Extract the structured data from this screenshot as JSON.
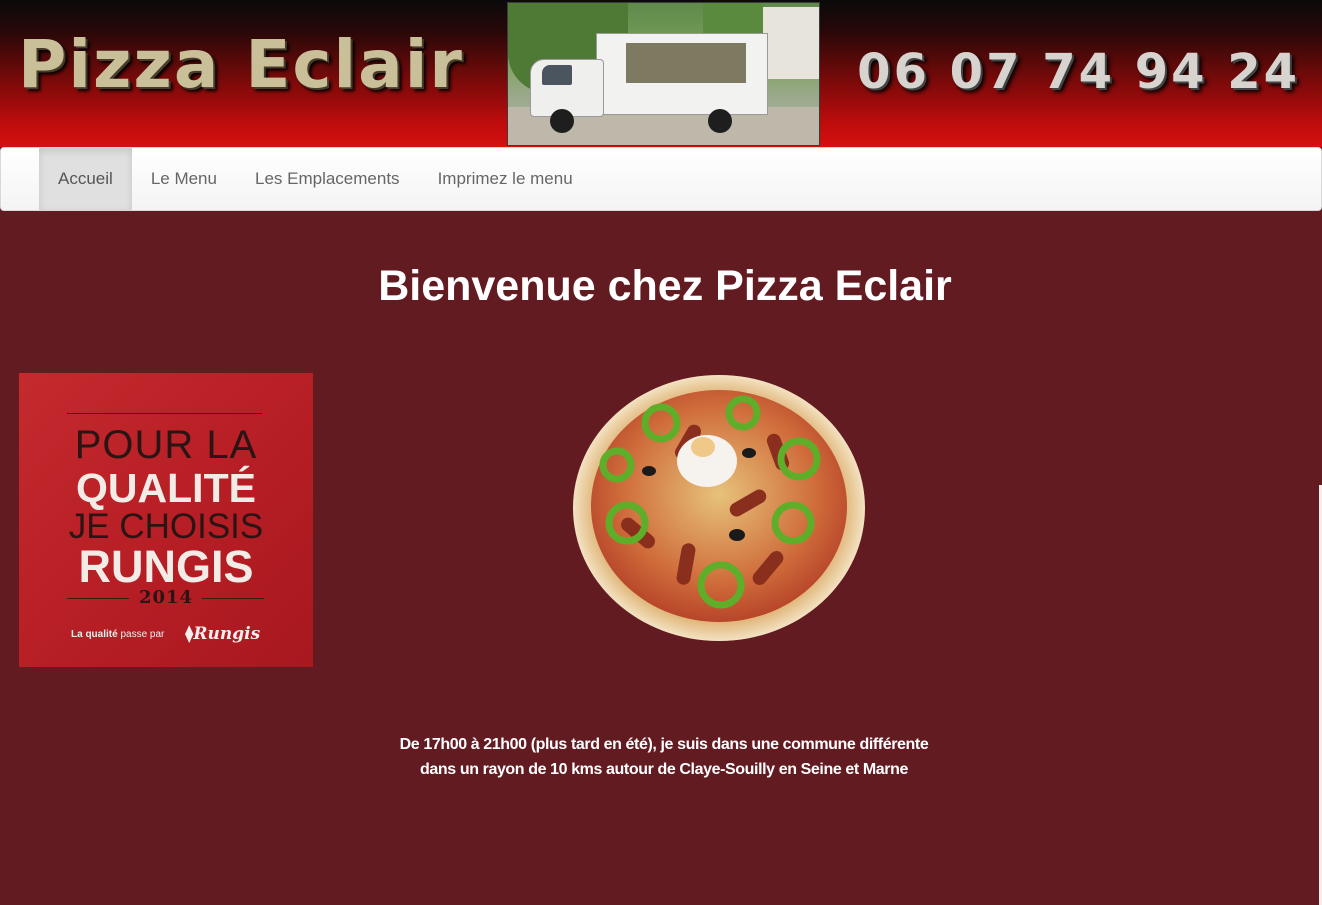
{
  "header": {
    "brand": "Pizza Eclair",
    "phone": "06 07 74 94 24",
    "photo": "food-truck-photo"
  },
  "nav": {
    "items": [
      {
        "label": "Accueil",
        "active": true
      },
      {
        "label": "Le Menu",
        "active": false
      },
      {
        "label": "Les Emplacements",
        "active": false
      },
      {
        "label": "Imprimez le menu",
        "active": false
      }
    ]
  },
  "main": {
    "title": "Bienvenue chez Pizza Eclair",
    "badge": {
      "line1": "POUR LA",
      "line2": "QUALITÉ",
      "line3": "JE CHOISIS",
      "line4": "RUNGIS",
      "year": "2014",
      "tagline_bold": "La qualité",
      "tagline_rest": " passe par",
      "logo": "Rungis"
    },
    "pizza_image": "pizza-photo",
    "intro": [
      "De 17h00 à 21h00 (plus tard en été), je suis dans une commune différente",
      "dans un rayon de 10 kms autour de Claye-Souilly en Seine et Marne"
    ]
  },
  "colors": {
    "page_bg": "#631b22",
    "banner_red": "#c10c0c",
    "nav_bg": "#f4f4f4",
    "nav_active": "#e0e0e0",
    "badge_red": "#b51d24"
  }
}
